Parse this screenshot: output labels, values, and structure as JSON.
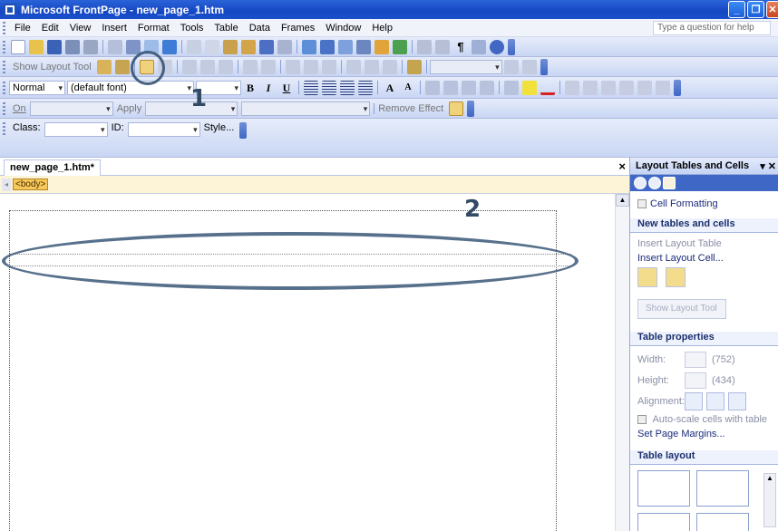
{
  "window": {
    "title": "Microsoft FrontPage - new_page_1.htm",
    "buttons": [
      "_",
      "❐",
      "✕"
    ]
  },
  "menu": {
    "items": [
      "File",
      "Edit",
      "View",
      "Insert",
      "Format",
      "Tools",
      "Table",
      "Data",
      "Frames",
      "Window",
      "Help"
    ],
    "help_placeholder": "Type a question for help"
  },
  "toolbars": {
    "tables": {
      "show_layout_tool": "Show Layout Tool"
    },
    "formatting": {
      "style": "Normal",
      "font": "(default font)",
      "size": ""
    },
    "dhtml": {
      "on_label": "On",
      "apply_label": "Apply",
      "remove_effect_label": "Remove Effect"
    },
    "style": {
      "class_label": "Class:",
      "id_label": "ID:",
      "style_button": "Style..."
    }
  },
  "document": {
    "tab": "new_page_1.htm*",
    "close": "×",
    "tag": "<body>"
  },
  "annotations": {
    "num1": "1",
    "num2": "2"
  },
  "taskpane": {
    "title": "Layout Tables and Cells",
    "cell_formatting": "Cell Formatting",
    "section_new": "New tables and cells",
    "insert_layout_table": "Insert Layout Table",
    "insert_layout_cell": "Insert Layout Cell...",
    "show_layout_tool": "Show Layout Tool",
    "section_props": "Table properties",
    "width_label": "Width:",
    "width_value": "(752)",
    "height_label": "Height:",
    "height_value": "(434)",
    "alignment_label": "Alignment:",
    "autoscale_label": "Auto-scale cells with table",
    "set_margins": "Set Page Margins...",
    "section_layout": "Table layout"
  }
}
